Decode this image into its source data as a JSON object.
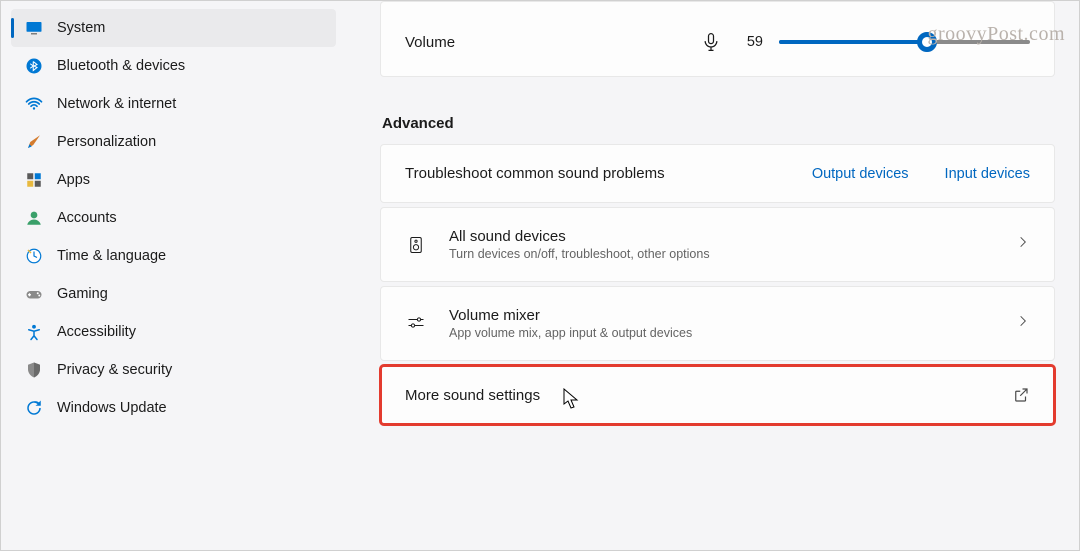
{
  "watermark": "groovyPost.com",
  "sidebar": {
    "items": [
      {
        "label": "System",
        "selected": true
      },
      {
        "label": "Bluetooth & devices",
        "selected": false
      },
      {
        "label": "Network & internet",
        "selected": false
      },
      {
        "label": "Personalization",
        "selected": false
      },
      {
        "label": "Apps",
        "selected": false
      },
      {
        "label": "Accounts",
        "selected": false
      },
      {
        "label": "Time & language",
        "selected": false
      },
      {
        "label": "Gaming",
        "selected": false
      },
      {
        "label": "Accessibility",
        "selected": false
      },
      {
        "label": "Privacy & security",
        "selected": false
      },
      {
        "label": "Windows Update",
        "selected": false
      }
    ]
  },
  "main": {
    "volume": {
      "label": "Volume",
      "value": "59",
      "percent": 59
    },
    "advanced_title": "Advanced",
    "troubleshoot": {
      "title": "Troubleshoot common sound problems",
      "output": "Output devices",
      "input": "Input devices"
    },
    "all_devices": {
      "title": "All sound devices",
      "sub": "Turn devices on/off, troubleshoot, other options"
    },
    "mixer": {
      "title": "Volume mixer",
      "sub": "App volume mix, app input & output devices"
    },
    "more": {
      "title": "More sound settings"
    }
  }
}
